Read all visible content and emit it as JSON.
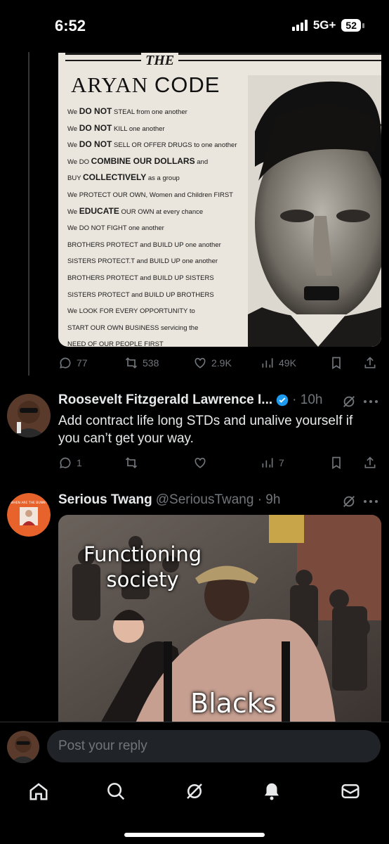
{
  "status_bar": {
    "time": "6:52",
    "network": "5G+",
    "battery": "52"
  },
  "tweet_1": {
    "image": {
      "the": "THE",
      "title_word1": "ARYAN",
      "title_word2": "CODE",
      "lines": [
        [
          "We ",
          "DO NOT",
          " STEAL from one another"
        ],
        [
          "We ",
          "DO NOT",
          " KILL one another"
        ],
        [
          "We ",
          "DO NOT",
          " SELL OR OFFER DRUGS to one another"
        ],
        [
          "We DO ",
          "COMBINE OUR DOLLARS",
          " and"
        ],
        [
          "BUY ",
          "COLLECTIVELY",
          " as a group"
        ],
        [
          "We PROTECT OUR OWN, Women and Children FIRST",
          "",
          ""
        ],
        [
          "We ",
          "EDUCATE",
          "  OUR OWN at every chance"
        ],
        [
          "We DO NOT FIGHT one another",
          "",
          ""
        ],
        [
          "BROTHERS PROTECT and BUILD UP one another",
          "",
          ""
        ],
        [
          "SISTERS PROTECT.T and BUILD UP one another",
          "",
          ""
        ],
        [
          "BROTHERS PROTECT and BUILD UP SISTERS",
          "",
          ""
        ],
        [
          "SISTERS PROTECT and BUILD UP BROTHERS",
          "",
          ""
        ],
        [
          "We LOOK FOR EVERY OPPORTUNITY to",
          "",
          ""
        ],
        [
          "START OUR OWN BUSINESS servicing the",
          "",
          ""
        ],
        [
          "NEED OF OUR PEOPLE FIRST",
          "",
          ""
        ]
      ]
    },
    "actions": {
      "replies": "77",
      "reposts": "538",
      "likes": "2.9K",
      "views": "49K"
    }
  },
  "tweet_2": {
    "name": "Roosevelt Fitzgerald Lawrence I...",
    "meta": "· 10h",
    "text": "Add contract life long STDs and unalive yourself if you can’t get your way.",
    "actions": {
      "replies": "1",
      "reposts": "",
      "likes": "",
      "views": "7"
    }
  },
  "tweet_3": {
    "name": "Serious Twang",
    "meta": "@SeriousTwang · 9h",
    "avatar_text": "WHEN ARE THE BUNNY",
    "image": {
      "caption_top": "Functioning\nsociety",
      "caption_bottom": "Blacks"
    }
  },
  "reply_bar": {
    "placeholder": "Post your reply"
  },
  "nav": [
    "home-icon",
    "search-icon",
    "grok-icon",
    "notifications-icon",
    "messages-icon"
  ],
  "colors": {
    "background": "#000000",
    "text": "#e7e9ea",
    "muted": "#71767b",
    "verified": "#1d9bf0"
  }
}
